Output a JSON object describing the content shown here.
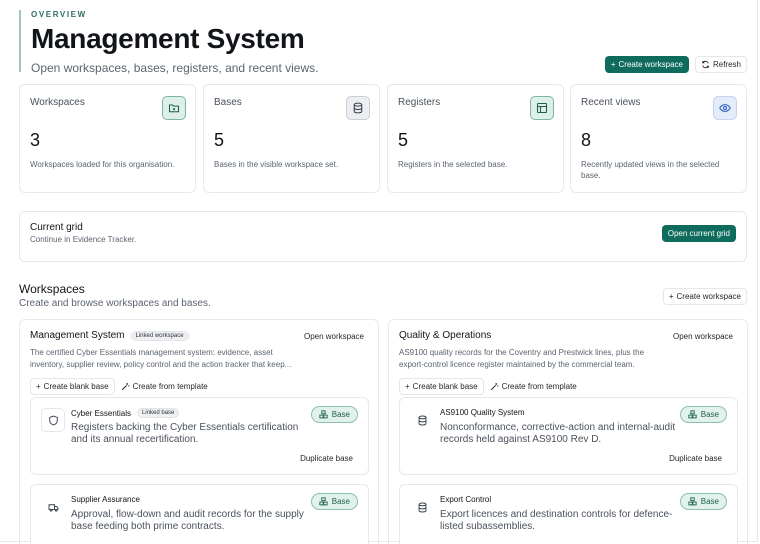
{
  "header": {
    "eyebrow": "OVERVIEW",
    "title": "Management System",
    "subtitle": "Open workspaces, bases, registers, and recent views.",
    "create_workspace": "Create workspace",
    "refresh": "Refresh"
  },
  "stats": [
    {
      "label": "Workspaces",
      "value": "3",
      "desc": "Workspaces loaded for this organisation.",
      "icon": "folder-icon"
    },
    {
      "label": "Bases",
      "value": "5",
      "desc": "Bases in the visible workspace set.",
      "icon": "database-icon"
    },
    {
      "label": "Registers",
      "value": "5",
      "desc": "Registers in the selected base.",
      "icon": "table-icon"
    },
    {
      "label": "Recent views",
      "value": "8",
      "desc": "Recently updated views in the selected base.",
      "icon": "eye-icon"
    }
  ],
  "current_grid": {
    "title": "Current grid",
    "subtitle": "Continue in Evidence Tracker.",
    "button": "Open current grid"
  },
  "workspaces_section": {
    "title": "Workspaces",
    "subtitle": "Create and browse workspaces and bases.",
    "create_button": "Create workspace"
  },
  "workspaces": [
    {
      "name": "Management System",
      "badge": "Linked workspace",
      "open": "Open workspace",
      "desc": "The certified Cyber Essentials management system: evidence, asset inventory, supplier review, policy control and the action tracker that keep...",
      "blank": "Create blank base",
      "template": "Create from template",
      "bases": [
        {
          "name": "Cyber Essentials",
          "badge": "Linked base",
          "desc": "Registers backing the Cyber Essentials certification and its annual recertification.",
          "pill": "Base",
          "dup": "Duplicate base",
          "icon": "shield-icon"
        },
        {
          "name": "Supplier Assurance",
          "badge": "",
          "desc": "Approval, flow-down and audit records for the supply base feeding both prime contracts.",
          "pill": "Base",
          "dup": "",
          "icon": "truck-icon"
        }
      ]
    },
    {
      "name": "Quality & Operations",
      "badge": "",
      "open": "Open workspace",
      "desc": "AS9100 quality records for the Coventry and Prestwick lines, plus the export-control licence register maintained by the commercial team.",
      "blank": "Create blank base",
      "template": "Create from template",
      "bases": [
        {
          "name": "AS9100 Quality System",
          "badge": "",
          "desc": "Nonconformance, corrective-action and internal-audit records held against AS9100 Rev D.",
          "pill": "Base",
          "dup": "Duplicate base",
          "icon": "database-icon"
        },
        {
          "name": "Export Control",
          "badge": "",
          "desc": "Export licences and destination controls for defence-listed subassemblies.",
          "pill": "Base",
          "dup": "",
          "icon": "database-icon"
        }
      ]
    }
  ],
  "colors": {
    "accent": "#0f6b5c",
    "pill_bg": "#e1f1eb"
  }
}
